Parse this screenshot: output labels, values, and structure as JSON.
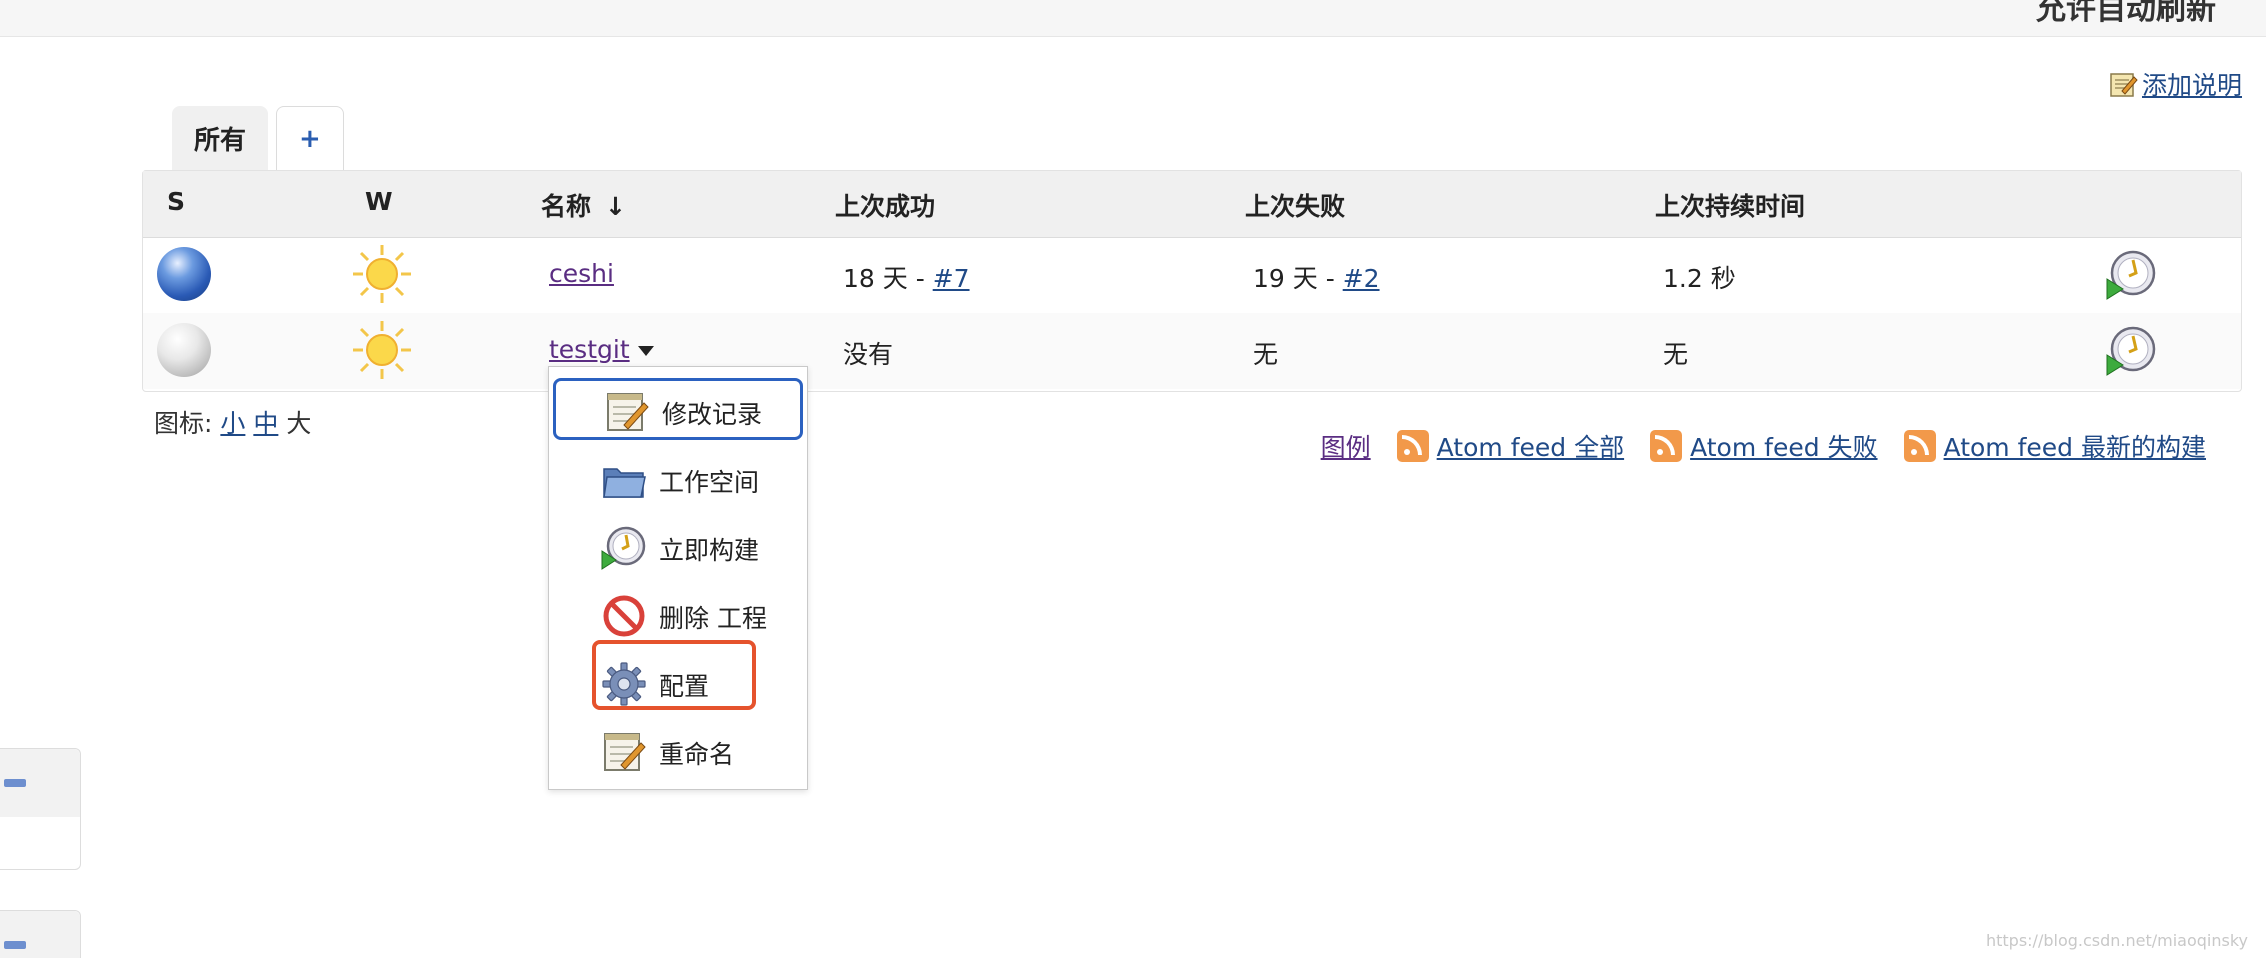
{
  "header": {
    "auto_refresh": "允许自动刷新"
  },
  "add_description": {
    "label": "添加说明",
    "icon": "notepad-icon"
  },
  "tabs": [
    {
      "label": "所有",
      "active": true
    },
    {
      "label": "+",
      "active": false
    }
  ],
  "table": {
    "columns": [
      "S",
      "W",
      "名称",
      "↓",
      "上次成功",
      "上次失败",
      "上次持续时间"
    ],
    "rows": [
      {
        "status": "blue-ball-icon",
        "weather": "sunny-icon",
        "name": "ceshi",
        "last_success_time": "18 天 - ",
        "last_success_build": "#7",
        "last_failure_time": "19 天 - ",
        "last_failure_build": "#2",
        "duration": "1.2 秒",
        "action": "schedule-build-icon"
      },
      {
        "status": "grey-ball-icon",
        "weather": "sunny-icon",
        "name": "testgit",
        "last_success": "没有",
        "last_failure": "无",
        "duration": "无",
        "action": "schedule-build-icon"
      }
    ]
  },
  "icon_size": {
    "label": "图标: ",
    "small": "小",
    "medium": "中",
    "large": "大"
  },
  "feeds": {
    "legend": "图例",
    "all": "Atom feed 全部",
    "failed": "Atom feed 失败",
    "latest": "Atom feed 最新的构建"
  },
  "context_menu": {
    "items": [
      {
        "label": "修改记录",
        "icon": "notepad-icon",
        "selected": true
      },
      {
        "label": "工作空间",
        "icon": "folder-icon"
      },
      {
        "label": "立即构建",
        "icon": "clock-build-icon"
      },
      {
        "label": "删除 工程",
        "icon": "no-entry-icon"
      },
      {
        "label": "配置",
        "icon": "gear-icon",
        "highlighted": true
      },
      {
        "label": "重命名",
        "icon": "notepad-icon"
      }
    ]
  },
  "watermark": "https://blog.csdn.net/miaoqinsky",
  "colors": {
    "link": "#204a87",
    "visited": "#5a2d82",
    "menu_selected_border": "#2b61c0",
    "annotation_box": "#e5532d"
  }
}
